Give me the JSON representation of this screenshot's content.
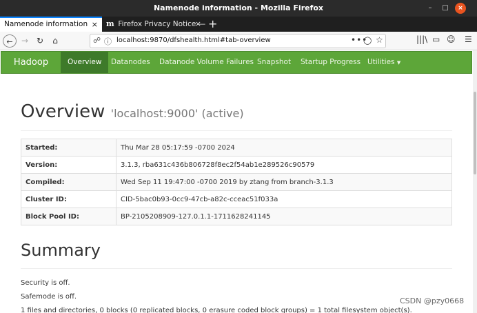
{
  "window": {
    "title": "Namenode information - Mozilla Firefox",
    "min_glyph": "–",
    "max_glyph": "□",
    "close_glyph": "×"
  },
  "tabs": [
    {
      "label": "Namenode information",
      "close": "×"
    },
    {
      "label": "Firefox Privacy Notice —",
      "logo": "m",
      "close": "×"
    }
  ],
  "new_tab": "+",
  "toolbar": {
    "back": "←",
    "forward": "→",
    "reload": "↻",
    "home": "⌂",
    "url": "localhost:9870/dfshealth.html#tab-overview",
    "page_actions": "•••",
    "library": "|||\\",
    "sidebar": "▭",
    "account": "☺",
    "menu": "☰"
  },
  "hadoop_nav": {
    "brand": "Hadoop",
    "items": [
      "Overview",
      "Datanodes",
      "Datanode Volume Failures",
      "Snapshot",
      "Startup Progress",
      "Utilities"
    ],
    "utilities_caret": "▼"
  },
  "overview": {
    "heading": "Overview",
    "subheading": "'localhost:9000' (active)",
    "rows": [
      {
        "key": "Started:",
        "value": "Thu Mar 28 05:17:59 -0700 2024"
      },
      {
        "key": "Version:",
        "value": "3.1.3, rba631c436b806728f8ec2f54ab1e289526c90579"
      },
      {
        "key": "Compiled:",
        "value": "Wed Sep 11 19:47:00 -0700 2019 by ztang from branch-3.1.3"
      },
      {
        "key": "Cluster ID:",
        "value": "CID-5bac0b93-0cc9-47cb-a82c-cceac51f033a"
      },
      {
        "key": "Block Pool ID:",
        "value": "BP-2105208909-127.0.1.1-1711628241145"
      }
    ]
  },
  "summary": {
    "heading": "Summary",
    "security": "Security is off.",
    "safemode": "Safemode is off.",
    "files": "1 files and directories, 0 blocks (0 replicated blocks, 0 erasure coded block groups) = 1 total filesystem object(s)."
  },
  "watermark": "CSDN @pzy0668",
  "colors": {
    "hadoop_green": "#5da639",
    "hadoop_active": "#3e7a2a",
    "firefox_blue": "#0a84ff"
  }
}
